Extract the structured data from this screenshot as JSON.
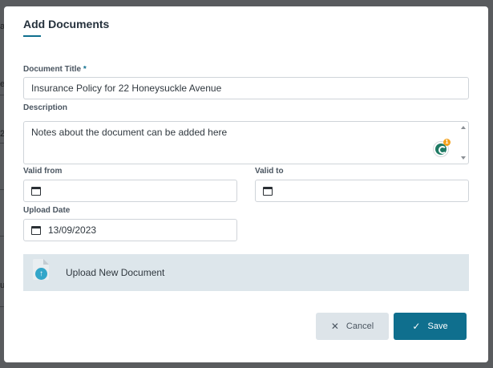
{
  "dialog": {
    "title": "Add Documents"
  },
  "form": {
    "document_title": {
      "label": "Document Title",
      "required_mark": "*",
      "value": "Insurance Policy for 22 Honeysuckle Avenue"
    },
    "description": {
      "label": "Description",
      "value": "Notes about the document can be added here"
    },
    "valid_from": {
      "label": "Valid from",
      "value": ""
    },
    "valid_to": {
      "label": "Valid to",
      "value": ""
    },
    "upload_date": {
      "label": "Upload Date",
      "value": "13/09/2023"
    }
  },
  "upload": {
    "label": "Upload New Document"
  },
  "grammar_widget": {
    "badge_count": "1",
    "icon": "grammarly-icon"
  },
  "buttons": {
    "cancel_label": "Cancel",
    "cancel_icon": "close-icon",
    "save_label": "Save",
    "save_icon": "check-icon"
  },
  "colors": {
    "accent": "#0f6f8e",
    "upload_panel_bg": "#dde6eb",
    "backdrop": "#595b5e"
  }
}
